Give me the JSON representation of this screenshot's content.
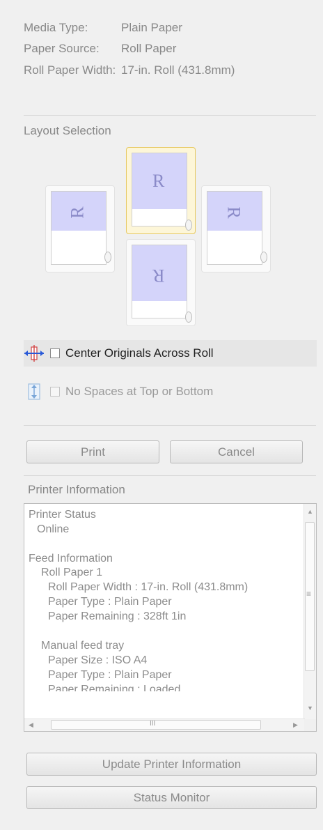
{
  "media_info": [
    {
      "label": "Media Type:",
      "value": "Plain Paper"
    },
    {
      "label": "Paper Source:",
      "value": "Roll Paper"
    },
    {
      "label": "Roll Paper Width:",
      "value": "17-in. Roll (431.8mm)"
    }
  ],
  "layout": {
    "title": "Layout Selection",
    "options": [
      {
        "letter": "R",
        "rotation": "normal",
        "selected": true
      },
      {
        "letter": "R",
        "rotation": "rotated-left",
        "selected": false
      },
      {
        "letter": "R",
        "rotation": "rotated-right",
        "selected": false
      },
      {
        "letter": "R",
        "rotation": "upside-down",
        "selected": false
      }
    ]
  },
  "options": {
    "center_originals": {
      "label": "Center Originals Across Roll",
      "checked": false,
      "enabled": true
    },
    "no_spaces": {
      "label": "No Spaces at Top or Bottom",
      "checked": false,
      "enabled": false
    }
  },
  "buttons": {
    "print": "Print",
    "cancel": "Cancel",
    "update": "Update Printer Information",
    "status_monitor": "Status Monitor"
  },
  "printer_info": {
    "title": "Printer Information",
    "lines": [
      "Printer Status",
      "   Online",
      "",
      "Feed Information",
      "   Roll Paper 1",
      "      Roll Paper Width : 17-in. Roll (431.8mm)",
      "      Paper Type : Plain Paper",
      "      Paper Remaining : 328ft 1in",
      "",
      "   Manual feed tray",
      "      Paper Size : ISO A4",
      "      Paper Type : Plain Paper",
      "      Paper Remaining : Loaded"
    ],
    "scroll_grip": "III",
    "vscroll_grip": "≡"
  },
  "colors": {
    "background": "#f0f0f0",
    "selection_fill": "#fdf6d8",
    "selection_border": "#e6c860",
    "image_fill": "#d4d4fa"
  }
}
